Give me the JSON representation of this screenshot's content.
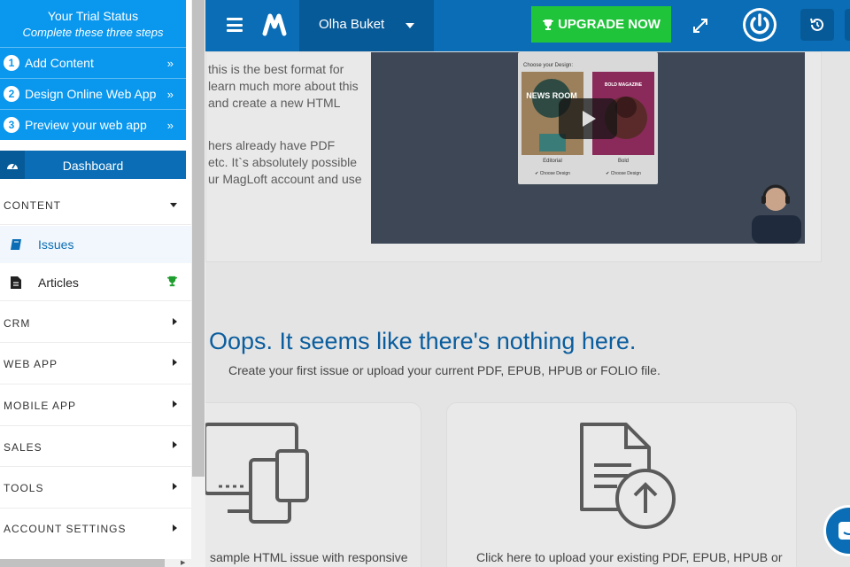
{
  "topbar": {
    "user_name": "Olha Buket",
    "upgrade_label": "UPGRADE NOW"
  },
  "trial": {
    "title": "Your Trial Status",
    "subtitle": "Complete these three steps",
    "steps": [
      {
        "num": "1",
        "label": "Add Content"
      },
      {
        "num": "2",
        "label": "Design Online Web App"
      },
      {
        "num": "3",
        "label": "Preview your web app"
      }
    ],
    "step_chevron": "»"
  },
  "sidebar": {
    "dashboard": "Dashboard",
    "content": "CONTENT",
    "issues": "Issues",
    "articles": "Articles",
    "crm": "CRM",
    "web_app": "WEB APP",
    "mobile_app": "MOBILE APP",
    "sales": "SALES",
    "tools": "TOOLS",
    "account_settings": "ACCOUNT SETTINGS"
  },
  "main": {
    "intro_lines_1": [
      "this is the best format for",
      "learn much more about this",
      "and create a new HTML"
    ],
    "intro_lines_2": [
      "hers already have PDF",
      "etc. It`s absolutely possible",
      "ur MagLoft account and use"
    ],
    "video": {
      "choose_label": "Choose your Design:",
      "design_1": "Editorial",
      "design_2": "Bold",
      "choose_btn": "✔ Choose Design",
      "thumb_1_text": "NEWS ROOM",
      "thumb_2_text": "BOLD MAGAZINE"
    },
    "empty_title": "Oops. It seems like there's nothing here.",
    "empty_sub": "Create your first issue or upload your current PDF, EPUB, HPUB or FOLIO file.",
    "option_1_text": "sample HTML issue with responsive",
    "option_2_text": "Click here to upload your existing PDF, EPUB, HPUB or"
  },
  "colors": {
    "brand_blue": "#0a6db5",
    "trial_blue": "#0a97ee",
    "upgrade_green": "#20c43a",
    "trophy_green": "#1e9e2e"
  }
}
